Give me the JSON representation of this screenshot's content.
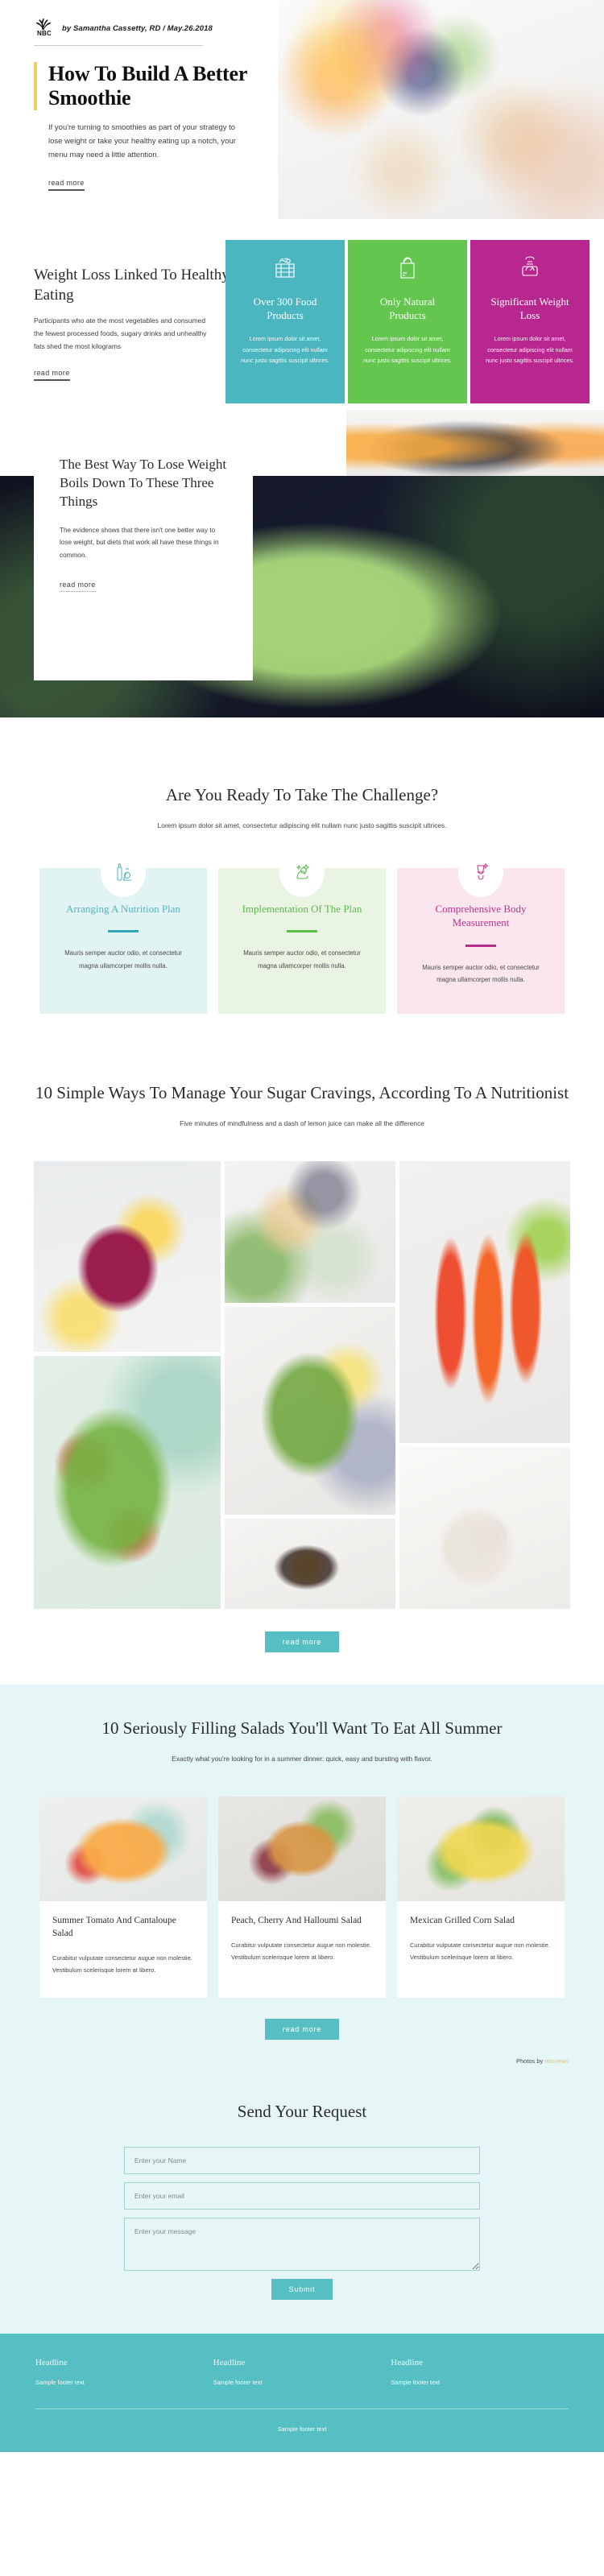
{
  "hero": {
    "logo_text": "NBC",
    "byline": "by Samantha Cassetty, RD / May.26.2018",
    "title": "How To Build A Better Smoothie",
    "paragraph": "If you're turning to smoothies as part of your strategy to lose weight or take your healthy eating up a notch, your menu may need a little attention.",
    "read_more": "read more",
    "image_alt": "fruit-platter-breakfast-photo"
  },
  "weight_loss": {
    "title": "Weight Loss Linked To Healthy Eating",
    "paragraph": "Participants who ate the most vegetables and consumed the fewest processed foods, sugary drinks and unhealthy fats shed the most kilograms",
    "read_more": "read more",
    "cards": [
      {
        "title": "Over 300 Food Products",
        "text": "Lorem ipsum dolor sit amet, consectetur adipiscing elit nullam nunc justo sagittis suscipit ultrices.",
        "color": "#4bb6bf",
        "icon": "vegetable-crate-icon"
      },
      {
        "title": "Only Natural Products",
        "text": "Lorem ipsum dolor sit amet, consectetur adipiscing elit nullam nunc justo sagittis suscipit ultrices.",
        "color": "#64c64f",
        "icon": "grocery-bag-icon"
      },
      {
        "title": "Significant Weight Loss",
        "text": "Lorem ipsum dolor sit amet, consectetur adipiscing elit nullam nunc justo sagittis suscipit ultrices.",
        "color": "#b7278f",
        "icon": "weight-scale-icon"
      }
    ]
  },
  "overlay": {
    "title": "The Best Way To Lose Weight Boils Down To These Three Things",
    "paragraph": "The evidence shows that there isn't one better way to lose weight, but diets that work all have these things in common.",
    "read_more": "read more",
    "image_alt": "green-tomato-salad-bowl-photo"
  },
  "challenge": {
    "heading": "Are You Ready To Take The Challenge?",
    "subheading": "Lorem ipsum dolor sit amet, consectetur adipiscing elit nullam nunc justo sagittis suscipit ultrices.",
    "cards": [
      {
        "title": "Arranging A Nutrition Plan",
        "text": "Mauris semper auctor odio, et consectetur magna ullamcorper mollis nulla.",
        "color": "#52b5be",
        "icon": "healthy-food-bottle-icon"
      },
      {
        "title": "Implementation Of The Plan",
        "text": "Mauris semper auctor odio, et consectetur magna ullamcorper mollis nulla.",
        "color": "#5cb84f",
        "icon": "flexed-arm-icon"
      },
      {
        "title": "Comprehensive Body Measurement",
        "text": "Mauris semper auctor odio, et consectetur magna ullamcorper mollis nulla.",
        "color": "#c0308f",
        "icon": "body-measure-icon"
      }
    ]
  },
  "gallery": {
    "heading": "10 Simple Ways To Manage Your Sugar Cravings, According To A Nutritionist",
    "subheading": "Five minutes of mindfulness and a dash of lemon juice can make all the difference",
    "read_more": "read more",
    "photos": [
      "berry-smoothie-jar-photo",
      "breakfast-spread-flatlay-photo",
      "strawberry-lime-cocktails-photo",
      "watercress-salad-bowl-photo",
      "garden-salad-tomato-photo",
      "fried-egg-salad-plate-photo",
      "fruit-yogurt-bowl-photo"
    ]
  },
  "salads": {
    "heading": "10 Seriously Filling Salads You'll Want To Eat All Summer",
    "subheading": "Exactly what you're looking for in a summer dinner: quick, easy and bursting with flavor.",
    "read_more": "read more",
    "cards": [
      {
        "title": "Summer Tomato And Cantaloupe Salad",
        "text": "Curabitur vulputate consectetur augue non molestie. Vestibulum scelerisque lorem at libero.",
        "image_alt": "cantaloupe-tomato-salad-photo"
      },
      {
        "title": "Peach, Cherry And Halloumi Salad",
        "text": "Curabitur vulputate consectetur augue non molestie. Vestibulum scelerisque lorem at libero.",
        "image_alt": "peach-cherry-halloumi-photo"
      },
      {
        "title": "Mexican Grilled Corn Salad",
        "text": "Curabitur vulputate consectetur augue non molestie. Vestibulum scelerisque lorem at libero.",
        "image_alt": "mexican-corn-salad-photo"
      }
    ],
    "credit_prefix": "Photos by",
    "credit_link": "nbcnews",
    "credit_link_color": "#e8c55c"
  },
  "form": {
    "heading": "Send Your Request",
    "name_placeholder": "Enter your Name",
    "email_placeholder": "Enter your email",
    "message_placeholder": "Enter your message",
    "name_value": "",
    "email_value": "",
    "message_value": "",
    "submit_label": "Submit"
  },
  "footer": {
    "background": "#56bfc4",
    "columns": [
      {
        "headline": "Headline",
        "text": "Sample footer text"
      },
      {
        "headline": "Headline",
        "text": "Sample footer text"
      },
      {
        "headline": "Headline",
        "text": "Sample footer text"
      }
    ],
    "bottom_text": "Sample footer text"
  }
}
